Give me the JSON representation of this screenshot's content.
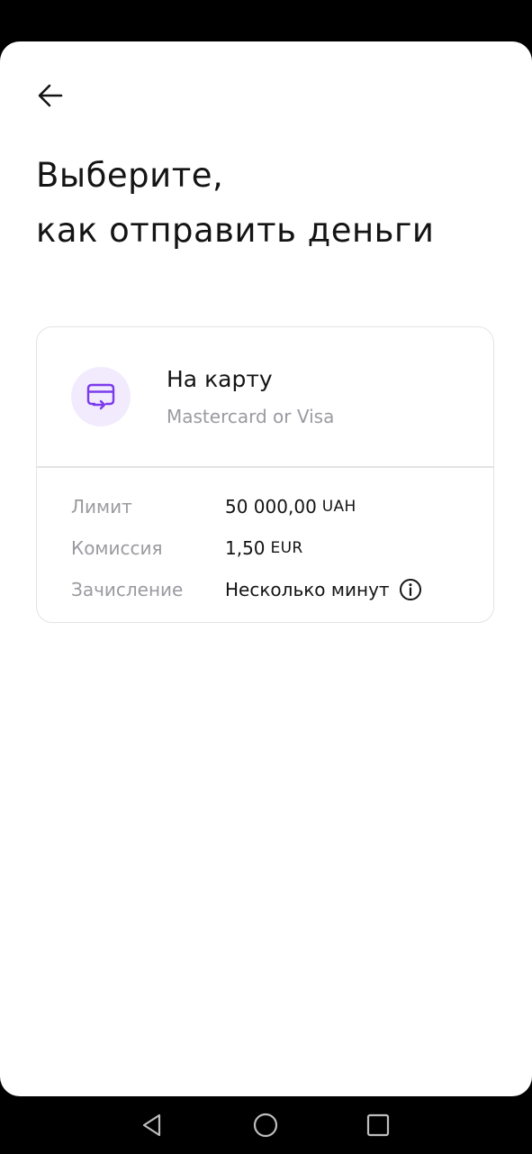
{
  "header": {
    "back_icon": "arrow-left-icon",
    "title_line1": "Выберите,",
    "title_line2": "как отправить деньги"
  },
  "method": {
    "icon": "card-transfer-icon",
    "name": "На карту",
    "subtitle": "Mastercard or Visa",
    "details": [
      {
        "label": "Лимит",
        "amount": "50 000,00",
        "unit": "UAH"
      },
      {
        "label": "Комиссия",
        "amount": "1,50",
        "unit": "EUR"
      },
      {
        "label": "Зачисление",
        "amount": "Несколько минут",
        "unit": ""
      }
    ],
    "info_icon": "info-circle-icon"
  },
  "navbar": {
    "back_icon": "nav-back-triangle-icon",
    "home_icon": "nav-home-circle-icon",
    "recents_icon": "nav-recents-square-icon"
  },
  "colors": {
    "accent": "#7c3aed",
    "icon_bg": "#f1ebfd",
    "text_primary": "#141414",
    "text_secondary": "#9a9aa0",
    "border": "#e3e3e6"
  }
}
